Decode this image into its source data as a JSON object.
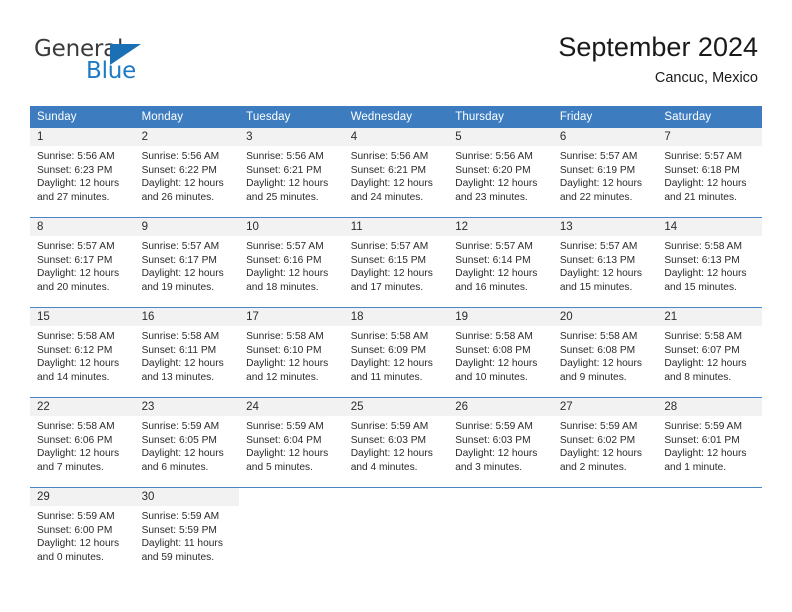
{
  "brand": {
    "name_top": "General",
    "name_bottom": "Blue",
    "color_top": "#3b3b3b",
    "color_bottom": "#1f7ac4",
    "triangle_color": "#1a6fb5"
  },
  "header": {
    "title": "September 2024",
    "subtitle": "Cancuc, Mexico"
  },
  "theme": {
    "header_row_bg": "#3d7dbf",
    "header_row_text": "#ffffff",
    "daynum_bg": "#f2f2f2",
    "row_separator": "#4a86c4",
    "body_text": "#2b2b2b"
  },
  "calendar": {
    "weekday_headers": [
      "Sunday",
      "Monday",
      "Tuesday",
      "Wednesday",
      "Thursday",
      "Friday",
      "Saturday"
    ],
    "labels": {
      "sunrise": "Sunrise:",
      "sunset": "Sunset:",
      "daylight": "Daylight:"
    },
    "weeks": [
      [
        {
          "day": "1",
          "sunrise": "Sunrise: 5:56 AM",
          "sunset": "Sunset: 6:23 PM",
          "daylight_line1": "Daylight: 12 hours",
          "daylight_line2": "and 27 minutes."
        },
        {
          "day": "2",
          "sunrise": "Sunrise: 5:56 AM",
          "sunset": "Sunset: 6:22 PM",
          "daylight_line1": "Daylight: 12 hours",
          "daylight_line2": "and 26 minutes."
        },
        {
          "day": "3",
          "sunrise": "Sunrise: 5:56 AM",
          "sunset": "Sunset: 6:21 PM",
          "daylight_line1": "Daylight: 12 hours",
          "daylight_line2": "and 25 minutes."
        },
        {
          "day": "4",
          "sunrise": "Sunrise: 5:56 AM",
          "sunset": "Sunset: 6:21 PM",
          "daylight_line1": "Daylight: 12 hours",
          "daylight_line2": "and 24 minutes."
        },
        {
          "day": "5",
          "sunrise": "Sunrise: 5:56 AM",
          "sunset": "Sunset: 6:20 PM",
          "daylight_line1": "Daylight: 12 hours",
          "daylight_line2": "and 23 minutes."
        },
        {
          "day": "6",
          "sunrise": "Sunrise: 5:57 AM",
          "sunset": "Sunset: 6:19 PM",
          "daylight_line1": "Daylight: 12 hours",
          "daylight_line2": "and 22 minutes."
        },
        {
          "day": "7",
          "sunrise": "Sunrise: 5:57 AM",
          "sunset": "Sunset: 6:18 PM",
          "daylight_line1": "Daylight: 12 hours",
          "daylight_line2": "and 21 minutes."
        }
      ],
      [
        {
          "day": "8",
          "sunrise": "Sunrise: 5:57 AM",
          "sunset": "Sunset: 6:17 PM",
          "daylight_line1": "Daylight: 12 hours",
          "daylight_line2": "and 20 minutes."
        },
        {
          "day": "9",
          "sunrise": "Sunrise: 5:57 AM",
          "sunset": "Sunset: 6:17 PM",
          "daylight_line1": "Daylight: 12 hours",
          "daylight_line2": "and 19 minutes."
        },
        {
          "day": "10",
          "sunrise": "Sunrise: 5:57 AM",
          "sunset": "Sunset: 6:16 PM",
          "daylight_line1": "Daylight: 12 hours",
          "daylight_line2": "and 18 minutes."
        },
        {
          "day": "11",
          "sunrise": "Sunrise: 5:57 AM",
          "sunset": "Sunset: 6:15 PM",
          "daylight_line1": "Daylight: 12 hours",
          "daylight_line2": "and 17 minutes."
        },
        {
          "day": "12",
          "sunrise": "Sunrise: 5:57 AM",
          "sunset": "Sunset: 6:14 PM",
          "daylight_line1": "Daylight: 12 hours",
          "daylight_line2": "and 16 minutes."
        },
        {
          "day": "13",
          "sunrise": "Sunrise: 5:57 AM",
          "sunset": "Sunset: 6:13 PM",
          "daylight_line1": "Daylight: 12 hours",
          "daylight_line2": "and 15 minutes."
        },
        {
          "day": "14",
          "sunrise": "Sunrise: 5:58 AM",
          "sunset": "Sunset: 6:13 PM",
          "daylight_line1": "Daylight: 12 hours",
          "daylight_line2": "and 15 minutes."
        }
      ],
      [
        {
          "day": "15",
          "sunrise": "Sunrise: 5:58 AM",
          "sunset": "Sunset: 6:12 PM",
          "daylight_line1": "Daylight: 12 hours",
          "daylight_line2": "and 14 minutes."
        },
        {
          "day": "16",
          "sunrise": "Sunrise: 5:58 AM",
          "sunset": "Sunset: 6:11 PM",
          "daylight_line1": "Daylight: 12 hours",
          "daylight_line2": "and 13 minutes."
        },
        {
          "day": "17",
          "sunrise": "Sunrise: 5:58 AM",
          "sunset": "Sunset: 6:10 PM",
          "daylight_line1": "Daylight: 12 hours",
          "daylight_line2": "and 12 minutes."
        },
        {
          "day": "18",
          "sunrise": "Sunrise: 5:58 AM",
          "sunset": "Sunset: 6:09 PM",
          "daylight_line1": "Daylight: 12 hours",
          "daylight_line2": "and 11 minutes."
        },
        {
          "day": "19",
          "sunrise": "Sunrise: 5:58 AM",
          "sunset": "Sunset: 6:08 PM",
          "daylight_line1": "Daylight: 12 hours",
          "daylight_line2": "and 10 minutes."
        },
        {
          "day": "20",
          "sunrise": "Sunrise: 5:58 AM",
          "sunset": "Sunset: 6:08 PM",
          "daylight_line1": "Daylight: 12 hours",
          "daylight_line2": "and 9 minutes."
        },
        {
          "day": "21",
          "sunrise": "Sunrise: 5:58 AM",
          "sunset": "Sunset: 6:07 PM",
          "daylight_line1": "Daylight: 12 hours",
          "daylight_line2": "and 8 minutes."
        }
      ],
      [
        {
          "day": "22",
          "sunrise": "Sunrise: 5:58 AM",
          "sunset": "Sunset: 6:06 PM",
          "daylight_line1": "Daylight: 12 hours",
          "daylight_line2": "and 7 minutes."
        },
        {
          "day": "23",
          "sunrise": "Sunrise: 5:59 AM",
          "sunset": "Sunset: 6:05 PM",
          "daylight_line1": "Daylight: 12 hours",
          "daylight_line2": "and 6 minutes."
        },
        {
          "day": "24",
          "sunrise": "Sunrise: 5:59 AM",
          "sunset": "Sunset: 6:04 PM",
          "daylight_line1": "Daylight: 12 hours",
          "daylight_line2": "and 5 minutes."
        },
        {
          "day": "25",
          "sunrise": "Sunrise: 5:59 AM",
          "sunset": "Sunset: 6:03 PM",
          "daylight_line1": "Daylight: 12 hours",
          "daylight_line2": "and 4 minutes."
        },
        {
          "day": "26",
          "sunrise": "Sunrise: 5:59 AM",
          "sunset": "Sunset: 6:03 PM",
          "daylight_line1": "Daylight: 12 hours",
          "daylight_line2": "and 3 minutes."
        },
        {
          "day": "27",
          "sunrise": "Sunrise: 5:59 AM",
          "sunset": "Sunset: 6:02 PM",
          "daylight_line1": "Daylight: 12 hours",
          "daylight_line2": "and 2 minutes."
        },
        {
          "day": "28",
          "sunrise": "Sunrise: 5:59 AM",
          "sunset": "Sunset: 6:01 PM",
          "daylight_line1": "Daylight: 12 hours",
          "daylight_line2": "and 1 minute."
        }
      ],
      [
        {
          "day": "29",
          "sunrise": "Sunrise: 5:59 AM",
          "sunset": "Sunset: 6:00 PM",
          "daylight_line1": "Daylight: 12 hours",
          "daylight_line2": "and 0 minutes."
        },
        {
          "day": "30",
          "sunrise": "Sunrise: 5:59 AM",
          "sunset": "Sunset: 5:59 PM",
          "daylight_line1": "Daylight: 11 hours",
          "daylight_line2": "and 59 minutes."
        },
        {
          "day": "",
          "sunrise": "",
          "sunset": "",
          "daylight_line1": "",
          "daylight_line2": ""
        },
        {
          "day": "",
          "sunrise": "",
          "sunset": "",
          "daylight_line1": "",
          "daylight_line2": ""
        },
        {
          "day": "",
          "sunrise": "",
          "sunset": "",
          "daylight_line1": "",
          "daylight_line2": ""
        },
        {
          "day": "",
          "sunrise": "",
          "sunset": "",
          "daylight_line1": "",
          "daylight_line2": ""
        },
        {
          "day": "",
          "sunrise": "",
          "sunset": "",
          "daylight_line1": "",
          "daylight_line2": ""
        }
      ]
    ]
  }
}
